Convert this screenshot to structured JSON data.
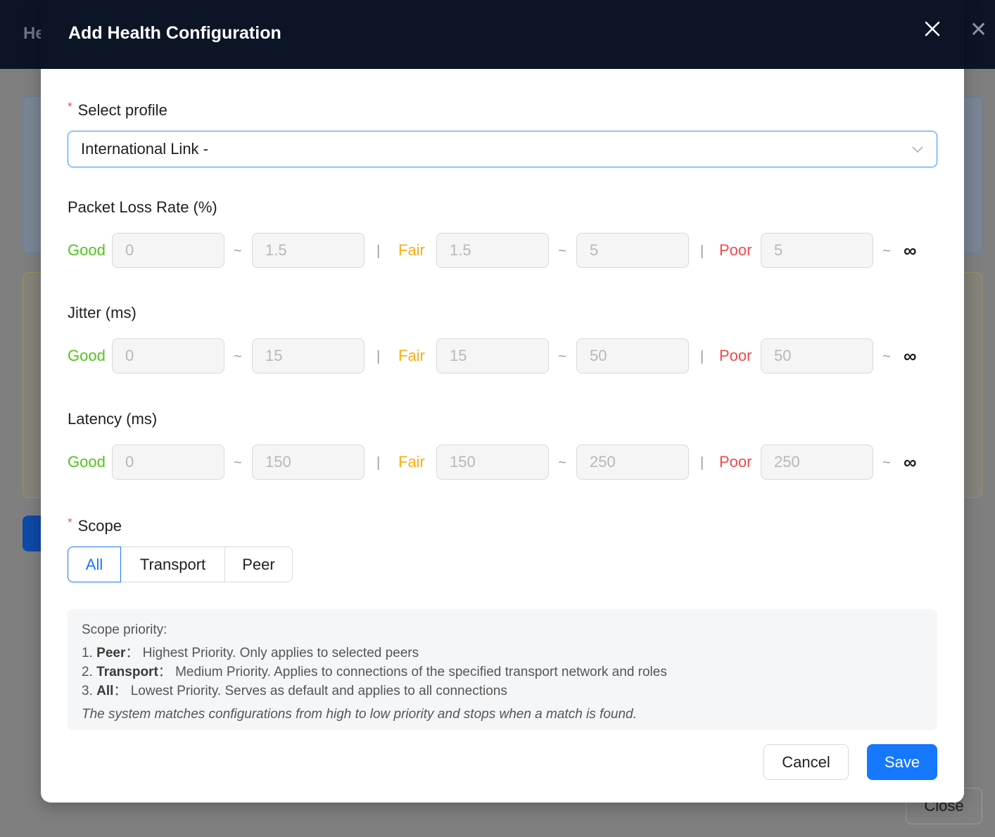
{
  "background": {
    "title": "He",
    "close_label": "Close"
  },
  "modal": {
    "title": "Add Health Configuration"
  },
  "profile": {
    "label": "Select profile",
    "value": "International Link -"
  },
  "levels": {
    "good": "Good",
    "fair": "Fair",
    "poor": "Poor",
    "tilde": "~",
    "bar": "|",
    "infinity": "∞"
  },
  "metrics": [
    {
      "title": "Packet Loss Rate (%)",
      "good_min": "0",
      "good_max": "1.5",
      "fair_min": "1.5",
      "fair_max": "5",
      "poor_min": "5"
    },
    {
      "title": "Jitter (ms)",
      "good_min": "0",
      "good_max": "15",
      "fair_min": "15",
      "fair_max": "50",
      "poor_min": "50"
    },
    {
      "title": "Latency (ms)",
      "good_min": "0",
      "good_max": "150",
      "fair_min": "150",
      "fair_max": "250",
      "poor_min": "250"
    }
  ],
  "scope": {
    "label": "Scope",
    "options": [
      "All",
      "Transport",
      "Peer"
    ],
    "selected": "All"
  },
  "priority": {
    "heading": "Scope priority:",
    "items": [
      {
        "num": "1.",
        "name": "Peer",
        "colon": "：",
        "desc": "Highest Priority. Only applies to selected peers"
      },
      {
        "num": "2.",
        "name": "Transport",
        "colon": "：",
        "desc": "Medium Priority. Applies to connections of the specified transport network and roles"
      },
      {
        "num": "3.",
        "name": "All",
        "colon": "：",
        "desc": "Lowest Priority. Serves as default and applies to all connections"
      }
    ],
    "note": "The system matches configurations from high to low priority and stops when a match is found."
  },
  "footer": {
    "cancel": "Cancel",
    "save": "Save"
  },
  "colors": {
    "good": "#52c41a",
    "fair": "#faad14",
    "poor": "#f5474a",
    "primary": "#1677ff",
    "header": "#0b1526"
  }
}
